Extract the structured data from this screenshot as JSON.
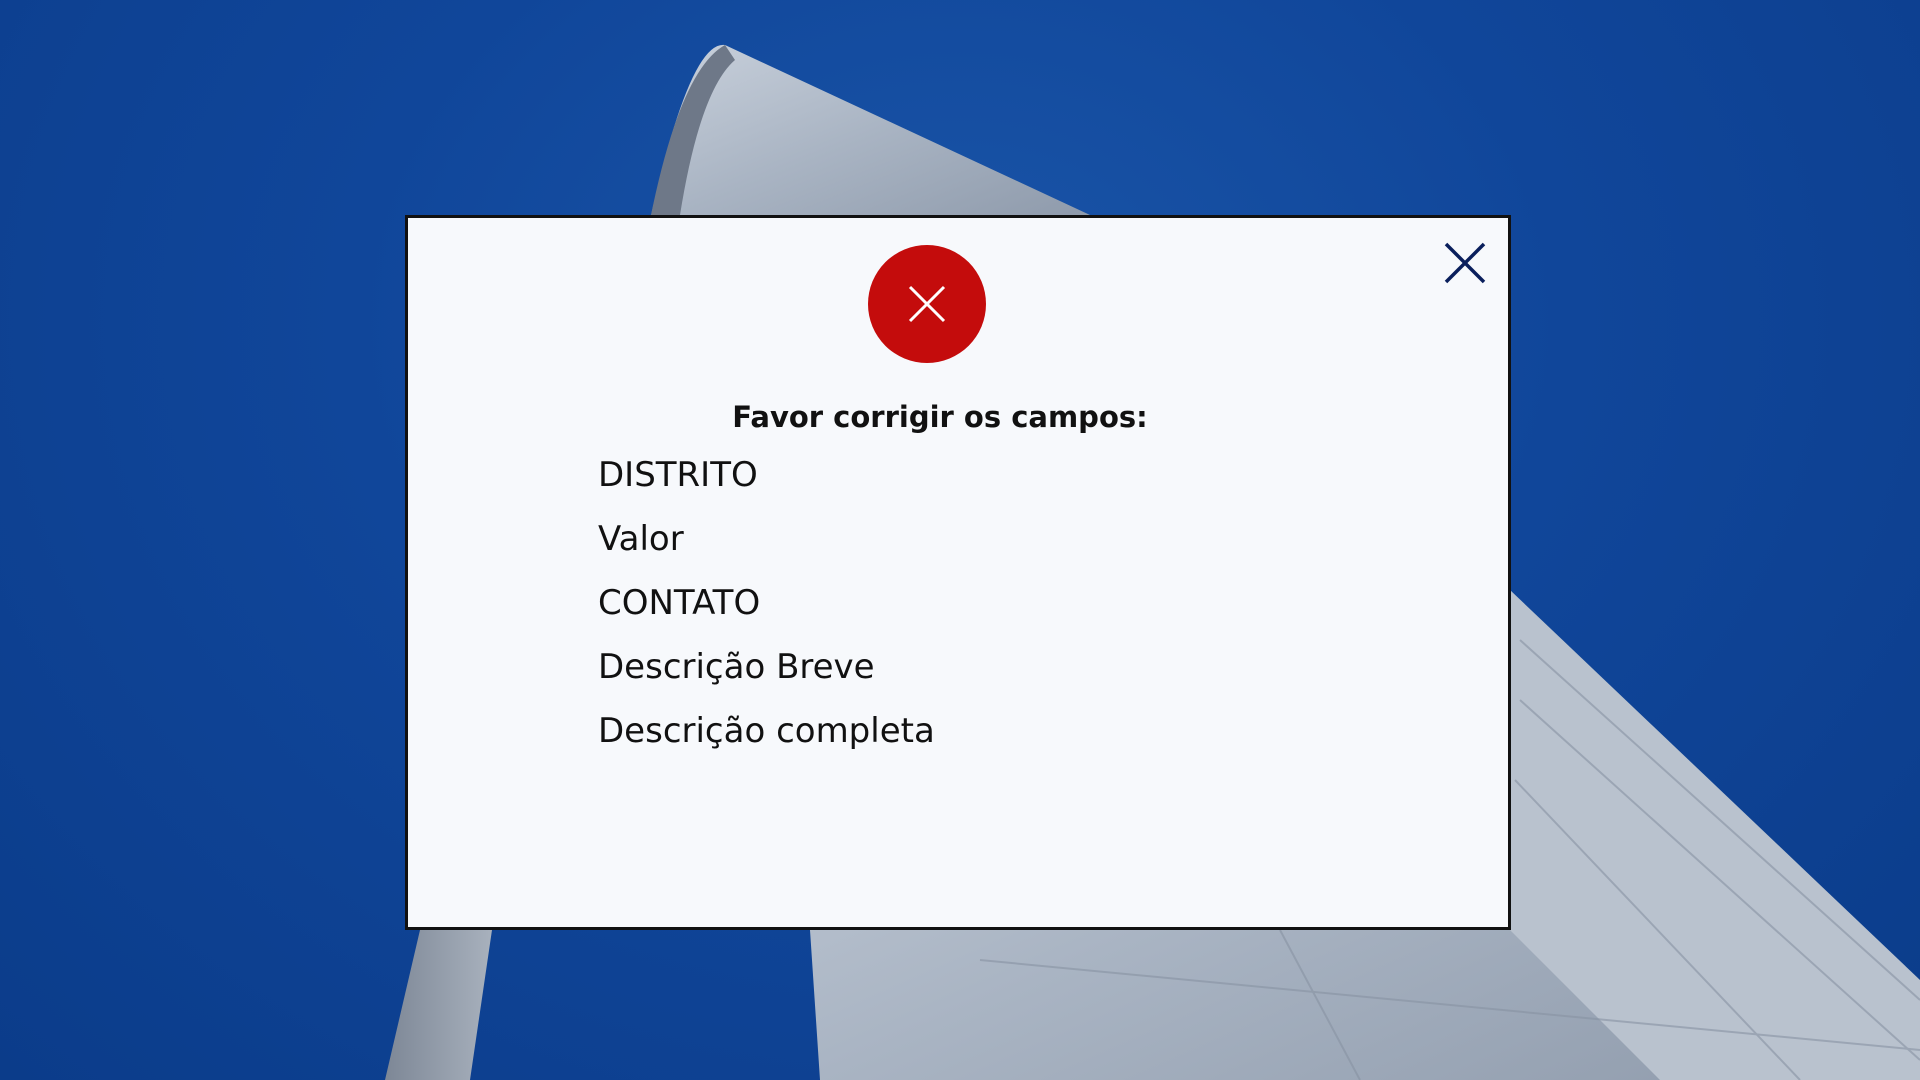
{
  "colors": {
    "sky": "#0f4597",
    "error_red": "#c40c0c",
    "close_icon": "#0a1f5c",
    "dialog_bg": "#ffffff",
    "dialog_border": "#111111"
  },
  "dialog": {
    "status_icon": "error-x-icon",
    "close_icon": "close-icon",
    "heading": "Favor corrigir os campos:",
    "fields": [
      "DISTRITO",
      "Valor",
      "CONTATO",
      "Descrição Breve",
      "Descrição completa"
    ]
  }
}
